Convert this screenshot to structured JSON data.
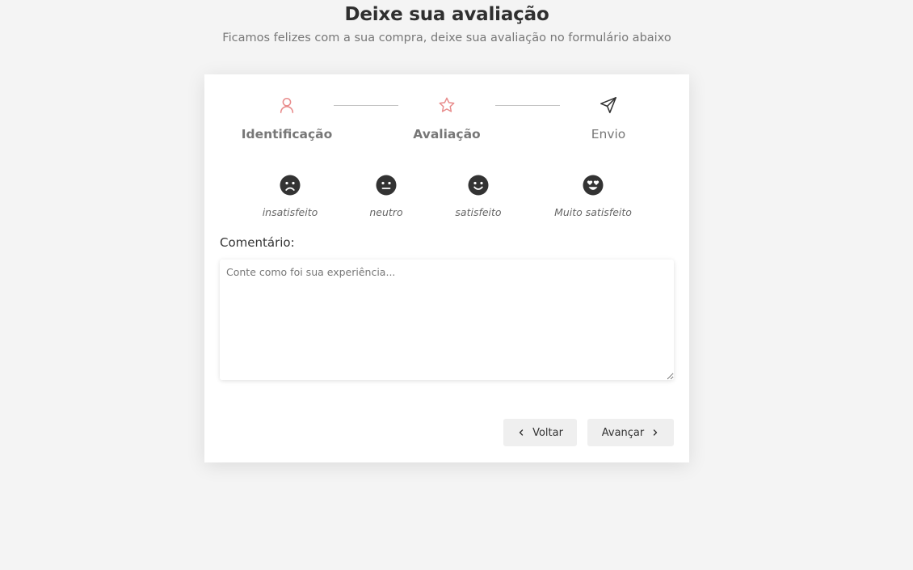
{
  "header": {
    "title": "Deixe sua avaliação",
    "subtitle": "Ficamos felizes com a sua compra, deixe sua avaliação no formulário abaixo"
  },
  "steps": [
    {
      "label": "Identificação",
      "icon": "user-icon",
      "active": true
    },
    {
      "label": "Avaliação",
      "icon": "star-icon",
      "active": true
    },
    {
      "label": "Envio",
      "icon": "send-icon",
      "active": false
    }
  ],
  "ratings": [
    {
      "label": "insatisfeito",
      "icon": "frown-face-icon"
    },
    {
      "label": "neutro",
      "icon": "neutral-face-icon"
    },
    {
      "label": "satisfeito",
      "icon": "smile-face-icon"
    },
    {
      "label": "Muito satisfeito",
      "icon": "heart-eyes-face-icon"
    }
  ],
  "comment": {
    "label": "Comentário:",
    "placeholder": "Conte como foi sua experiência...",
    "value": ""
  },
  "buttons": {
    "back": "Voltar",
    "next": "Avançar"
  },
  "colors": {
    "accent": "#e88b8b",
    "background": "#f4f4f4",
    "card": "#ffffff",
    "button_bg": "#efefef",
    "face": "#333333"
  }
}
